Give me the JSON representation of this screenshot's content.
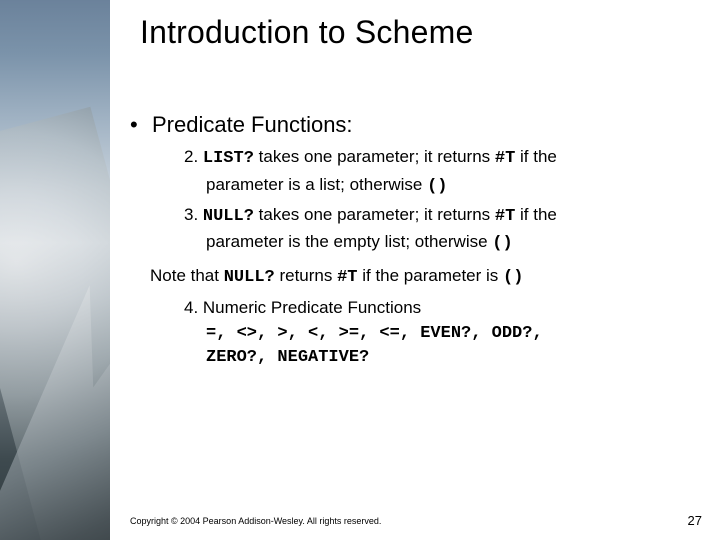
{
  "title": "Introduction to Scheme",
  "heading": "Predicate Functions:",
  "item2_num": "2. ",
  "item2_fn": "LIST?",
  "item2_text1": " takes one parameter; it returns ",
  "item2_tok1": "#T",
  "item2_text2": " if the",
  "item2_cont1": "parameter is a list; otherwise ",
  "item2_tok2": "()",
  "item3_num": "3. ",
  "item3_fn": "NULL?",
  "item3_text1": " takes one parameter; it returns ",
  "item3_tok1": "#T",
  "item3_text2": " if the",
  "item3_cont1": "parameter is the empty list; otherwise ",
  "item3_tok2": "()",
  "note_pre": "Note that ",
  "note_fn": "NULL?",
  "note_mid": " returns ",
  "note_tok1": "#T",
  "note_mid2": " if the parameter is ",
  "note_tok2": "()",
  "item4": "4. Numeric Predicate Functions",
  "ops_line1": "=, <>, >, <, >=, <=, EVEN?, ODD?,",
  "ops_line2": "ZERO?, NEGATIVE?",
  "copyright": "Copyright © 2004 Pearson Addison-Wesley. All rights reserved.",
  "page": "27"
}
